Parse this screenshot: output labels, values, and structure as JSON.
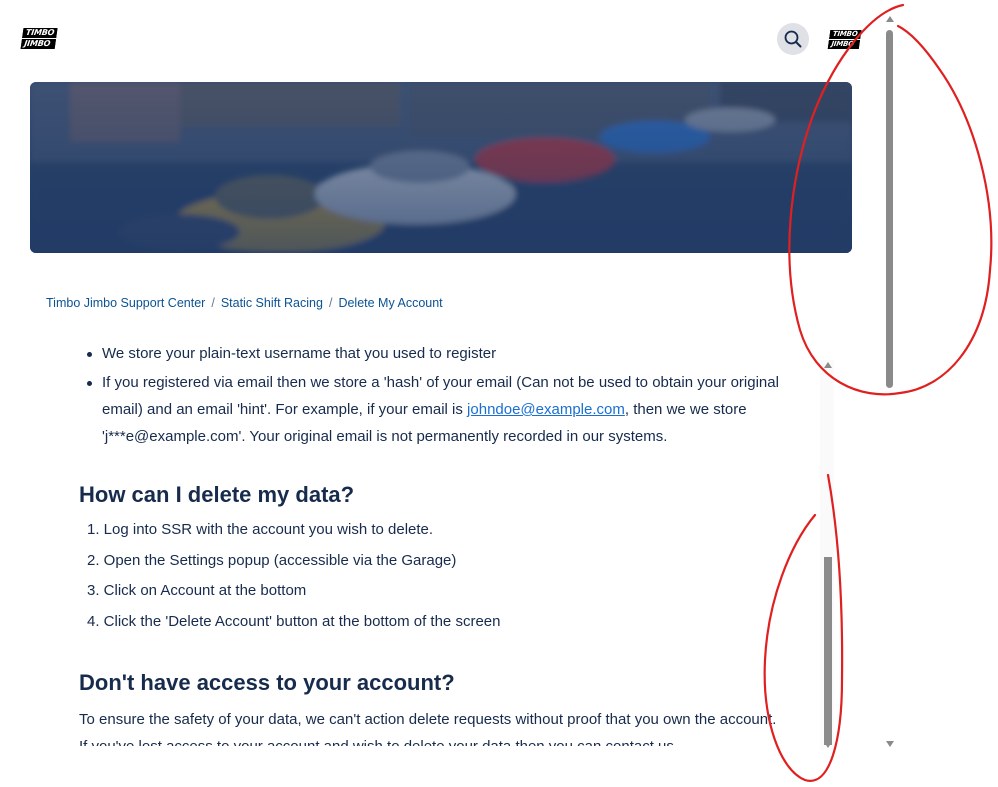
{
  "header": {
    "logo_left": [
      "TIMBO",
      "JIMBO"
    ],
    "logo_right": [
      "TIMBO",
      "JIMBO"
    ],
    "search_icon": "search-icon"
  },
  "breadcrumb": {
    "items": [
      "Timbo Jimbo Support Center",
      "Static Shift Racing",
      "Delete My Account"
    ],
    "separator": "/"
  },
  "content": {
    "bullets": [
      {
        "text_before": "We store your plain-text username that you used to register",
        "link": "",
        "text_after": ""
      },
      {
        "text_before": "If you registered via email then we store a 'hash' of your email (Can not be used to obtain your original email) and an email 'hint'. For example, if your email is ",
        "link": "johndoe@example.com",
        "text_after": ", then we we store 'j***e@example.com'. Your original email is not permanently recorded in our systems."
      }
    ],
    "heading_delete": "How can I delete my data?",
    "steps": [
      "1. Log into SSR with the account you wish to delete.",
      "2. Open the Settings popup (accessible via the Garage)",
      "3. Click on Account at the bottom",
      "4. Click the 'Delete Account' button at the bottom of the screen"
    ],
    "heading_access": "Don't have access to your account?",
    "paragraph_access": "To ensure the safety of your data, we can't action delete requests without proof that you own the account. If you've lost access to your account and wish to delete your data then you can contact us"
  },
  "colors": {
    "link": "#1a6fd0",
    "breadcrumb_link": "#0b5394",
    "annotation": "#e02020",
    "scroll_thumb": "#8a8a8a"
  }
}
